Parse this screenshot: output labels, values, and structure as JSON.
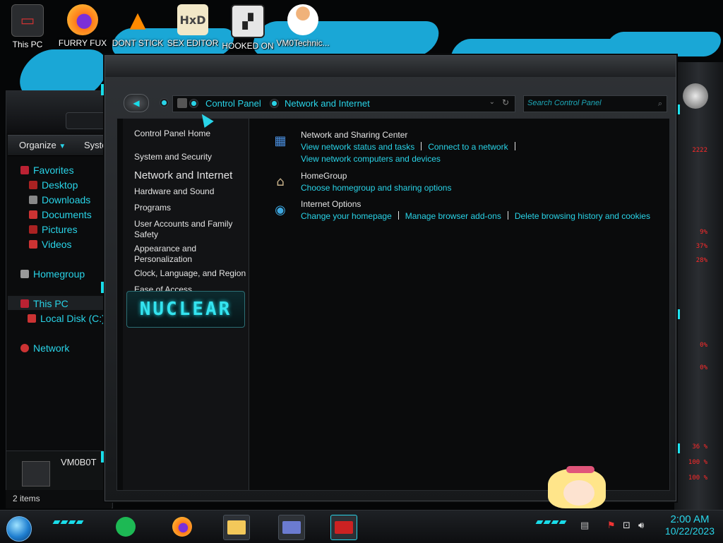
{
  "desktop": {
    "icons": [
      {
        "label": "This PC",
        "icon": "computer-icon"
      },
      {
        "label": "FURRY FUX",
        "icon": "firefox-icon"
      },
      {
        "label": "DONT STICK",
        "icon": "vlc-cone-icon"
      },
      {
        "label": "SEX EDITOR",
        "icon": "hxd-editor-icon"
      },
      {
        "label": "HOOKED ON",
        "icon": "app-icon"
      },
      {
        "label": "VM0Technic...",
        "icon": "doctor-avatar-icon"
      }
    ]
  },
  "explorer": {
    "toolbar": {
      "organize": "Organize",
      "system": "Syste"
    },
    "nav": {
      "favorites": "Favorites",
      "desktop": "Desktop",
      "downloads": "Downloads",
      "documents": "Documents",
      "pictures": "Pictures",
      "videos": "Videos",
      "homegroup": "Homegroup",
      "this_pc": "This PC",
      "local_disk": "Local Disk (C:)",
      "network": "Network"
    },
    "footer_name": "VM0B0T",
    "status": "2 items"
  },
  "control_panel": {
    "breadcrumb": [
      "Control Panel",
      "Network and Internet"
    ],
    "search_placeholder": "Search Control Panel",
    "left_nav": {
      "home": "Control Panel Home",
      "system_security": "System and Security",
      "network_internet": "Network and Internet",
      "hardware_sound": "Hardware and Sound",
      "programs": "Programs",
      "user_accounts": "User Accounts and Family Safety",
      "appearance": "Appearance and Personalization",
      "clock_language": "Clock, Language, and Region",
      "ease_access": "Ease of Access"
    },
    "banner": "NUCLEAR",
    "categories": {
      "network_sharing": {
        "title": "Network and Sharing Center",
        "links": [
          "View network status and tasks",
          "Connect to a network",
          "View network computers and devices"
        ]
      },
      "homegroup": {
        "title": "HomeGroup",
        "links": [
          "Choose homegroup and sharing options"
        ]
      },
      "internet_options": {
        "title": "Internet Options",
        "links": [
          "Change your homepage",
          "Manage browser add-ons",
          "Delete browsing history and cookies"
        ]
      }
    }
  },
  "side_readouts": [
    "2222",
    "9%",
    "37%",
    "28%",
    "0%",
    "0%",
    "36 %",
    "100 %",
    "100 %"
  ],
  "taskbar": {
    "time": "2:00 AM",
    "date": "10/22/2023"
  },
  "colors": {
    "accent": "#29d4e8",
    "wallpaper_stroke": "#1aa7d6",
    "readout": "#ff2a2a"
  }
}
